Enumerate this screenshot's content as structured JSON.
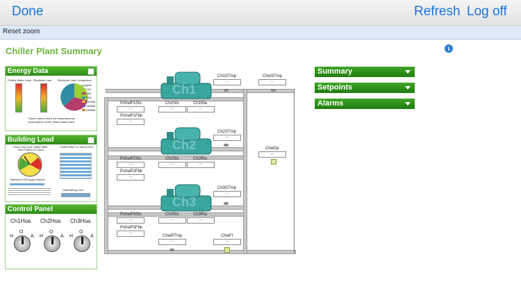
{
  "nav": {
    "done": "Done",
    "refresh": "Refresh",
    "logoff": "Log off"
  },
  "toolbar": {
    "reset_zoom": "Reset zoom"
  },
  "page": {
    "title": "Chiller Plant Summary"
  },
  "panels": {
    "energy": {
      "title": "Energy Data",
      "chart1_title": "Chilled Water Load",
      "chart2_title": "Electrical Load",
      "chart3_title": "Electrical Load Comparison",
      "legend_title": "Legend",
      "legend_items": [
        "Ch1",
        "Ch2",
        "Ch3",
        "Ch1kW",
        "Ch2kW",
        "Ch3kW"
      ],
      "footer": "These meters show the instantaneous consumption of the chilled water plant."
    },
    "building": {
      "title": "Building Load",
      "gauge_title": "Worst Case Zone Chilled Water Valve Position (% Open)",
      "bars_title": "Chilled Water % Load by Floor",
      "setpoint_label": "Optimized CHW Supply Setpoint",
      "total_label": "Total Building Load"
    },
    "control": {
      "title": "Control Panel",
      "switches": [
        {
          "label": "Ch1Hoa",
          "h": "H",
          "o": "O",
          "a": "A"
        },
        {
          "label": "Ch2Hoa",
          "h": "H",
          "o": "O",
          "a": "A"
        },
        {
          "label": "Ch3Hoa",
          "h": "H",
          "o": "O",
          "a": "A"
        }
      ]
    }
  },
  "diagram": {
    "chillers": [
      "Ch1",
      "Ch2",
      "Ch3"
    ],
    "value_placeholder": "---",
    "labels": {
      "ch1stmp": "Ch1STmp",
      "chwstmp": "ChwSTmp",
      "pchwp1sts": "PchwP1Sts",
      "ch1sts": "Ch1Sts",
      "ch1rla": "Ch1Rla",
      "pchwp1fbk": "PchwP1Fbk",
      "ch2stmp": "Ch2STmp",
      "chwdp": "ChwDp",
      "pchwp2sts": "PchwP2Sts",
      "ch2sts": "Ch2Sts",
      "ch2rla": "Ch2Rla",
      "pchwp2fbk": "PchwP2Fbk",
      "ch3stmp": "Ch3STmp",
      "pchwp3sts": "PchwP3Sts",
      "ch3sts": "Ch3Sts",
      "ch3rla": "Ch3Rla",
      "pchwp3fbk": "PchwP3Fbk",
      "chwrtmp": "ChwRTmp",
      "chwfl": "ChwFl"
    }
  },
  "right_panels": [
    "Summary",
    "Setpoints",
    "Alarms"
  ],
  "colors": {
    "accent": "#6fb43f",
    "nav_text": "#1a73d9",
    "chiller": "#3aa59c"
  }
}
